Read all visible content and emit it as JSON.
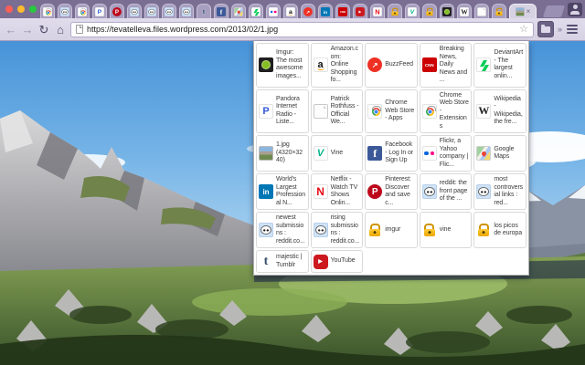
{
  "theme": {
    "colors": {
      "frame": "#7a6e93",
      "tab": "#a89fc0",
      "active-tab": "#d7d2e3",
      "toolbar": "#d7d2e3",
      "urlbar": "#ffffff",
      "panel-bg": "#ffffff",
      "pressed": "#6b6184"
    }
  },
  "tab_strip": {
    "tabs": [
      {
        "icon": "chrome-web-store"
      },
      {
        "icon": "reddit"
      },
      {
        "icon": "chrome-web-store"
      },
      {
        "icon": "pandora"
      },
      {
        "icon": "pinterest"
      },
      {
        "icon": "reddit"
      },
      {
        "icon": "reddit"
      },
      {
        "icon": "reddit"
      },
      {
        "icon": "reddit"
      },
      {
        "icon": "tumblr"
      },
      {
        "icon": "facebook"
      },
      {
        "icon": "google-maps"
      },
      {
        "icon": "deviantart"
      },
      {
        "icon": "flickr"
      },
      {
        "icon": "amazon"
      },
      {
        "icon": "buzzfeed"
      },
      {
        "icon": "linkedin"
      },
      {
        "icon": "cnn"
      },
      {
        "icon": "youtube"
      },
      {
        "icon": "netflix"
      },
      {
        "icon": "lock"
      },
      {
        "icon": "vine"
      },
      {
        "icon": "lock"
      },
      {
        "icon": "imgur"
      },
      {
        "icon": "wikipedia"
      },
      {
        "icon": "document"
      },
      {
        "icon": "lock"
      }
    ],
    "active_tab": {
      "icon": "image-thumb",
      "close_glyph": "×"
    }
  },
  "toolbar": {
    "back_glyph": "←",
    "forward_glyph": "→",
    "reload_glyph": "↻",
    "home_glyph": "⌂",
    "url": "https://tevatelleva.files.wordpress.com/2013/02/1.jpg",
    "bookmark_star_glyph": "☆",
    "overflow_glyph": "»"
  },
  "bookmarks_panel": {
    "items": [
      {
        "icon": "imgur",
        "label": "Imgur: The most awesome images..."
      },
      {
        "icon": "amazon",
        "label": "Amazon.com: Online Shopping fo..."
      },
      {
        "icon": "buzzfeed",
        "label": "BuzzFeed"
      },
      {
        "icon": "cnn",
        "label": "Breaking News, Daily News and ..."
      },
      {
        "icon": "deviantart",
        "label": "DeviantArt - The largest onlin..."
      },
      {
        "icon": "pandora",
        "label": "Pandora Internet Radio - Liste..."
      },
      {
        "icon": "document",
        "label": "Patrick Rothfuss - Official We..."
      },
      {
        "icon": "chrome-web-store",
        "label": "Chrome Web Store - Apps"
      },
      {
        "icon": "chrome-web-store",
        "label": "Chrome Web Store - Extensions"
      },
      {
        "icon": "wikipedia",
        "label": "Wikipedia - Wikipedia, the fre..."
      },
      {
        "icon": "image-thumb",
        "label": "1.jpg (4320×3240)"
      },
      {
        "icon": "vine",
        "label": "Vine"
      },
      {
        "icon": "facebook",
        "label": "Facebook - Log In or Sign Up"
      },
      {
        "icon": "flickr",
        "label": "Flickr, a Yahoo company | Flic..."
      },
      {
        "icon": "google-maps",
        "label": "Google Maps"
      },
      {
        "icon": "linkedin",
        "label": "World's Largest Professional N..."
      },
      {
        "icon": "netflix",
        "label": "Netflix - Watch TV Shows Onlin..."
      },
      {
        "icon": "pinterest",
        "label": "Pinterest: Discover and save c..."
      },
      {
        "icon": "reddit",
        "label": "reddit: the front page of the ..."
      },
      {
        "icon": "reddit",
        "label": "most controversial links : red..."
      },
      {
        "icon": "reddit",
        "label": "newest submissions : reddit.co..."
      },
      {
        "icon": "reddit",
        "label": "rising submissions : reddit.co..."
      },
      {
        "icon": "lock",
        "label": "imgur"
      },
      {
        "icon": "lock",
        "label": "vine"
      },
      {
        "icon": "lock",
        "label": "los picos de europa"
      },
      {
        "icon": "tumblr",
        "label": "majestic | Tumblr"
      },
      {
        "icon": "youtube",
        "label": "YouTube"
      }
    ]
  }
}
